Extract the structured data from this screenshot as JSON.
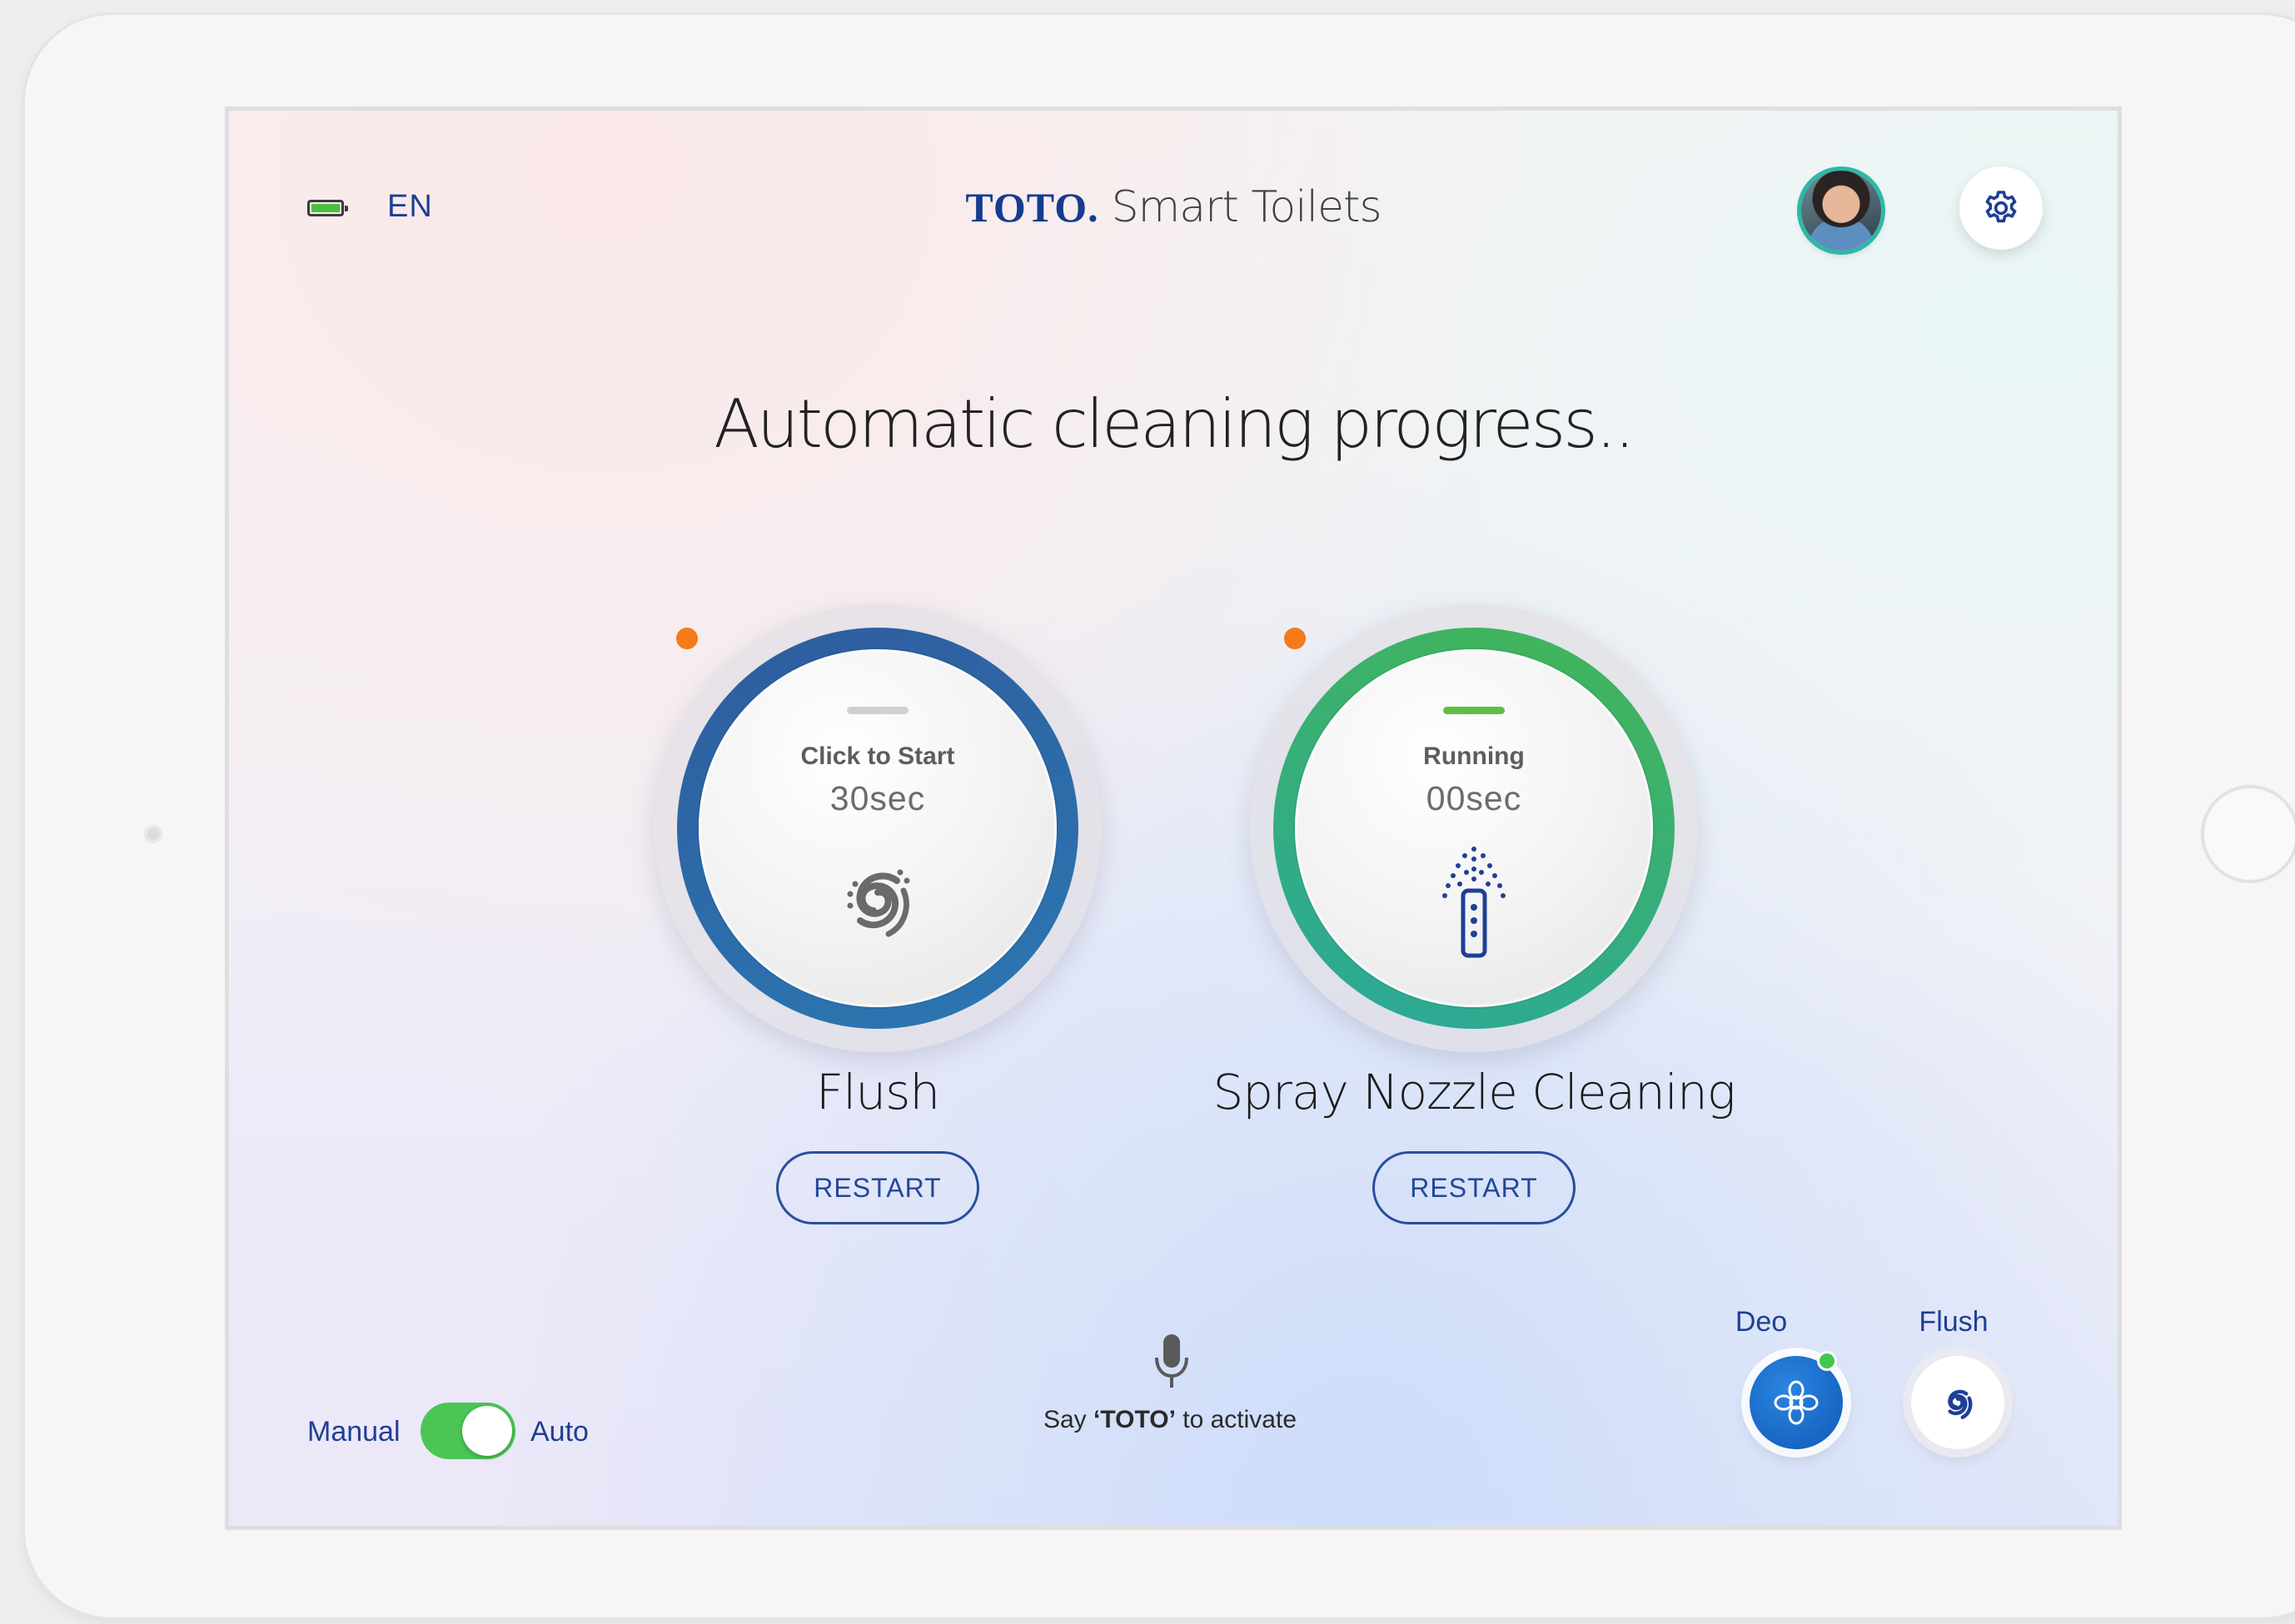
{
  "header": {
    "language": "EN",
    "brand_logo": "TOTO.",
    "brand_name": "Smart Toilets",
    "battery_level": 1.0
  },
  "main": {
    "title": "Automatic cleaning progress..",
    "dials": [
      {
        "status": "Click to Start",
        "time": "30sec",
        "label": "Flush",
        "button": "RESTART",
        "ring_colors": [
          "#2f5c9e",
          "#2b78b2"
        ],
        "bar_color": "#d0d0d0"
      },
      {
        "status": "Running",
        "time": "00sec",
        "label": "Spray Nozzle Cleaning",
        "button": "RESTART",
        "ring_colors": [
          "#2aa89c",
          "#44b556"
        ],
        "bar_color": "#5dbf45"
      }
    ]
  },
  "footer": {
    "mode_manual": "Manual",
    "mode_auto": "Auto",
    "mode_selected": "Auto",
    "voice_prefix": "Say ",
    "voice_keyword": "‘TOTO’",
    "voice_suffix": " to activate",
    "quick_deo_label": "Deo",
    "quick_flush_label": "Flush"
  },
  "colors": {
    "accent_navy": "#1e3f95",
    "toggle_green": "#4cc557",
    "indicator_orange": "#f47a1a"
  },
  "icons": [
    "battery-icon",
    "gear-icon",
    "swirl-icon",
    "spray-nozzle-icon",
    "microphone-icon",
    "flower-icon"
  ]
}
